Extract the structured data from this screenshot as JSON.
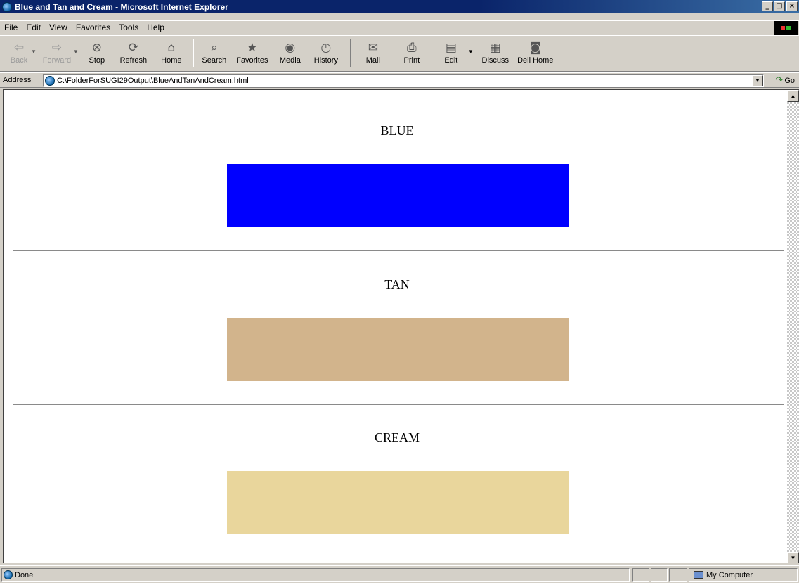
{
  "window": {
    "title": "Blue and Tan and Cream - Microsoft Internet Explorer",
    "controls": {
      "minimize": "_",
      "maximize": "□",
      "close": "×"
    }
  },
  "menu": [
    "File",
    "Edit",
    "View",
    "Favorites",
    "Tools",
    "Help"
  ],
  "toolbar": {
    "back": "Back",
    "forward": "Forward",
    "stop": "Stop",
    "refresh": "Refresh",
    "home": "Home",
    "search": "Search",
    "favorites": "Favorites",
    "media": "Media",
    "history": "History",
    "mail": "Mail",
    "print": "Print",
    "edit": "Edit",
    "discuss": "Discuss",
    "dell_home": "Dell Home"
  },
  "address": {
    "label": "Address",
    "url": "C:\\FolderForSUGI29Output\\BlueAndTanAndCream.html",
    "go": "Go"
  },
  "page": {
    "sections": [
      {
        "title": "BLUE",
        "color": "#0000ff"
      },
      {
        "title": "TAN",
        "color": "#d2b48c"
      },
      {
        "title": "CREAM",
        "color": "#e9d69c"
      }
    ]
  },
  "status": {
    "text": "Done",
    "zone": "My Computer"
  }
}
